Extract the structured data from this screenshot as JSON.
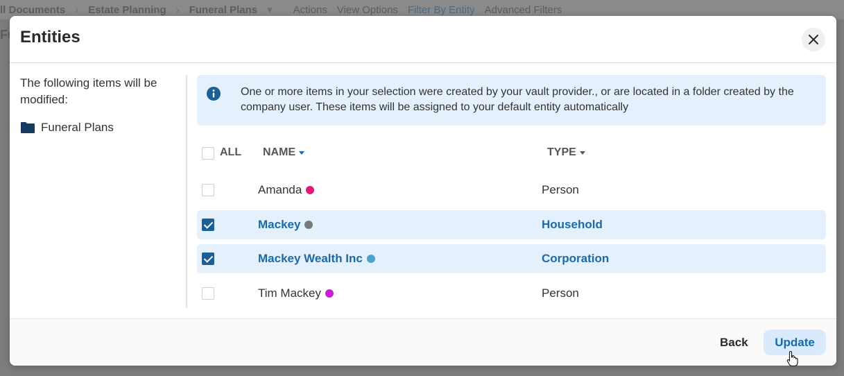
{
  "background": {
    "breadcrumb": [
      "ll Documents",
      "Estate Planning",
      "Funeral Plans"
    ],
    "toolbar": [
      "Actions",
      "View Options",
      "Filter By Entity",
      "Advanced Filters"
    ],
    "left_edge_char": "Fu"
  },
  "modal": {
    "title": "Entities",
    "left_pane": {
      "intro": "The following items will be modified:",
      "items": [
        {
          "icon": "folder-icon",
          "label": "Funeral Plans"
        }
      ]
    },
    "info": {
      "icon": "info-icon",
      "text": "One or more items in your selection were created by your vault provider., or are located in a folder created by the company user. These items will be assigned to your default entity automatically"
    },
    "table": {
      "headers": {
        "all": "ALL",
        "name": "NAME",
        "type": "TYPE"
      },
      "rows": [
        {
          "name": "Amanda",
          "type": "Person",
          "checked": false,
          "color": "#e0197d"
        },
        {
          "name": "Mackey",
          "type": "Household",
          "checked": true,
          "color": "#7a7a7a"
        },
        {
          "name": "Mackey Wealth Inc",
          "type": "Corporation",
          "checked": true,
          "color": "#4aa3c8"
        },
        {
          "name": "Tim Mackey",
          "type": "Person",
          "checked": false,
          "color": "#c81ed2"
        }
      ]
    },
    "footer": {
      "back_label": "Back",
      "update_label": "Update"
    }
  },
  "colors": {
    "accent": "#1b6aa8",
    "selected_row_bg": "#e4f0fb",
    "checkbox_checked": "#1b5f95"
  }
}
